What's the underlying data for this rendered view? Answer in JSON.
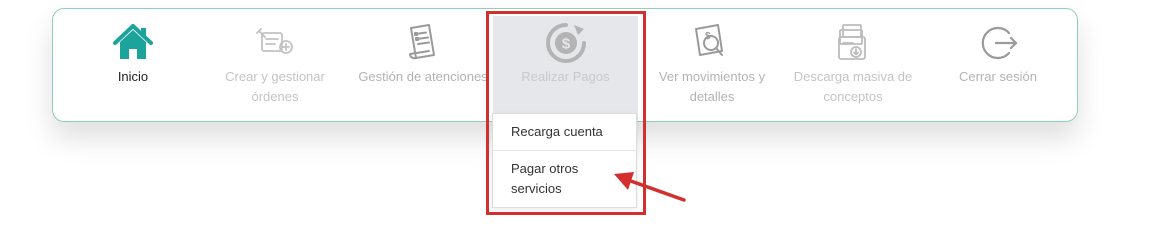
{
  "nav": {
    "items": [
      {
        "label": "Inicio",
        "icon": "home-icon",
        "state": "active"
      },
      {
        "label": "Crear y gestionar órdenes",
        "icon": "create-orders-icon",
        "state": "muted"
      },
      {
        "label": "Gestión de atenciones",
        "icon": "document-list-icon",
        "state": "default"
      },
      {
        "label": "Realizar Pagos",
        "icon": "payment-dollar-icon",
        "state": "hovered"
      },
      {
        "label": "Ver movimientos y detalles",
        "icon": "movements-search-icon",
        "state": "default"
      },
      {
        "label": "Descarga masiva de conceptos",
        "icon": "bulk-download-icon",
        "state": "muted"
      },
      {
        "label": "Cerrar sesión",
        "icon": "logout-icon",
        "state": "default"
      }
    ]
  },
  "dropdown": {
    "items": [
      {
        "label": "Recarga cuenta"
      },
      {
        "label": "Pagar otros servicios"
      }
    ]
  },
  "annotation": {
    "highlight_color": "#d32f2f"
  },
  "colors": {
    "accent": "#1ba39c",
    "border": "#8fcfc0",
    "icon_gray": "#a7a7a7"
  }
}
